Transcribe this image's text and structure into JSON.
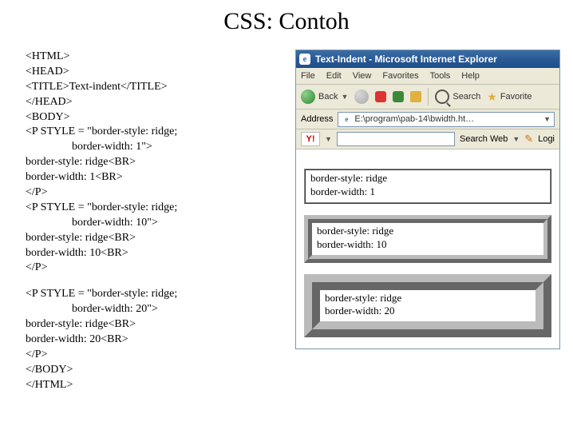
{
  "title": "CSS: Contoh",
  "code": {
    "l1": "<HTML>",
    "l2": "<HEAD>",
    "l3": "<TITLE>Text-indent</TITLE>",
    "l4": "</HEAD>",
    "l5": "<BODY>",
    "l6": "<P STYLE = \"border-style: ridge;",
    "l7": "border-width: 1\">",
    "l8": "border-style: ridge<BR>",
    "l9": "border-width: 1<BR>",
    "l10": "</P>",
    "l11": "<P STYLE = \"border-style: ridge;",
    "l12": "border-width: 10\">",
    "l13": "border-style: ridge<BR>",
    "l14": "border-width: 10<BR>",
    "l15": "</P>",
    "l16": "<P STYLE = \"border-style: ridge;",
    "l17": "border-width: 20\">",
    "l18": "border-style: ridge<BR>",
    "l19": "border-width: 20<BR>",
    "l20": "</P>",
    "l21": "</BODY>",
    "l22": "</HTML>"
  },
  "browser": {
    "window_title": "Text-Indent - Microsoft Internet Explorer",
    "menu": {
      "file": "File",
      "edit": "Edit",
      "view": "View",
      "favorites": "Favorites",
      "tools": "Tools",
      "help": "Help"
    },
    "toolbar": {
      "back": "Back",
      "search": "Search",
      "favorites": "Favorite"
    },
    "address_label": "Address",
    "address_value": "E:\\program\\pab-14\\bwidth.ht…",
    "yahoo_search": "Search Web",
    "yahoo_login": "Logi",
    "content": {
      "p1a": "border-style: ridge",
      "p1b": "border-width: 1",
      "p2a": "border-style: ridge",
      "p2b": "border-width: 10",
      "p3a": "border-style: ridge",
      "p3b": "border-width: 20"
    }
  }
}
